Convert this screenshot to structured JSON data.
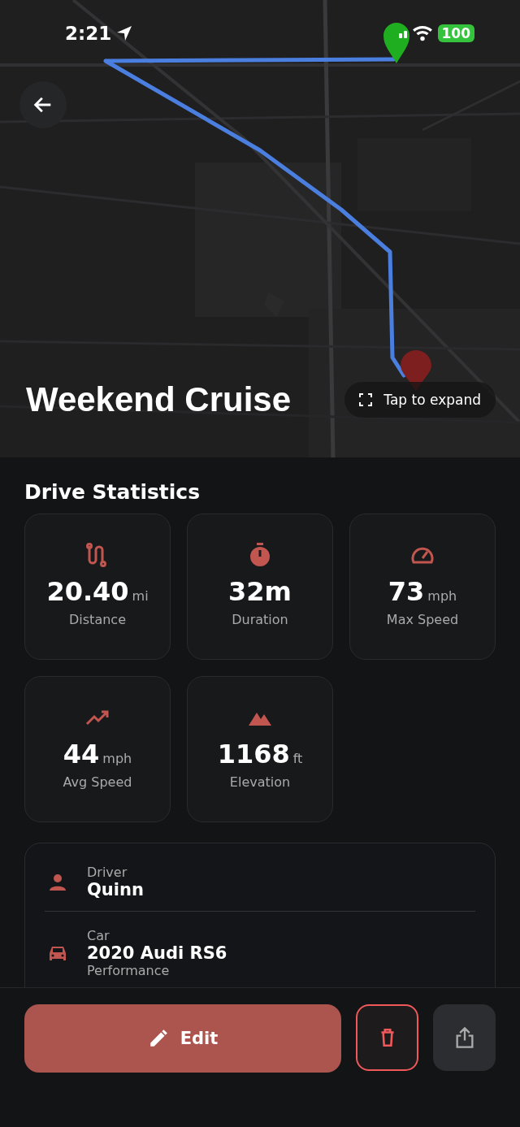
{
  "status_bar": {
    "time": "2:21",
    "battery": "100"
  },
  "title": "Weekend Cruise",
  "expand_button": {
    "label": "Tap to expand"
  },
  "section_title": "Drive Statistics",
  "stats": [
    {
      "kind": "distance",
      "value": "20.40",
      "unit": "mi",
      "label": "Distance"
    },
    {
      "kind": "duration",
      "value": "32m",
      "label": "Duration"
    },
    {
      "kind": "speed",
      "value": "73",
      "unit": "mph",
      "label": "Max Speed"
    },
    {
      "kind": "trend",
      "value": "44",
      "unit": "mph",
      "label": "Avg Speed"
    },
    {
      "kind": "elevation",
      "value": "1168",
      "unit": "ft",
      "label": "Elevation"
    }
  ],
  "details": [
    {
      "kind": "driver",
      "label": "Driver",
      "value": "Quinn"
    },
    {
      "kind": "car",
      "label": "Car",
      "value": "2020 Audi RS6",
      "note": "Performance"
    }
  ],
  "actions": {
    "edit": "Edit"
  }
}
